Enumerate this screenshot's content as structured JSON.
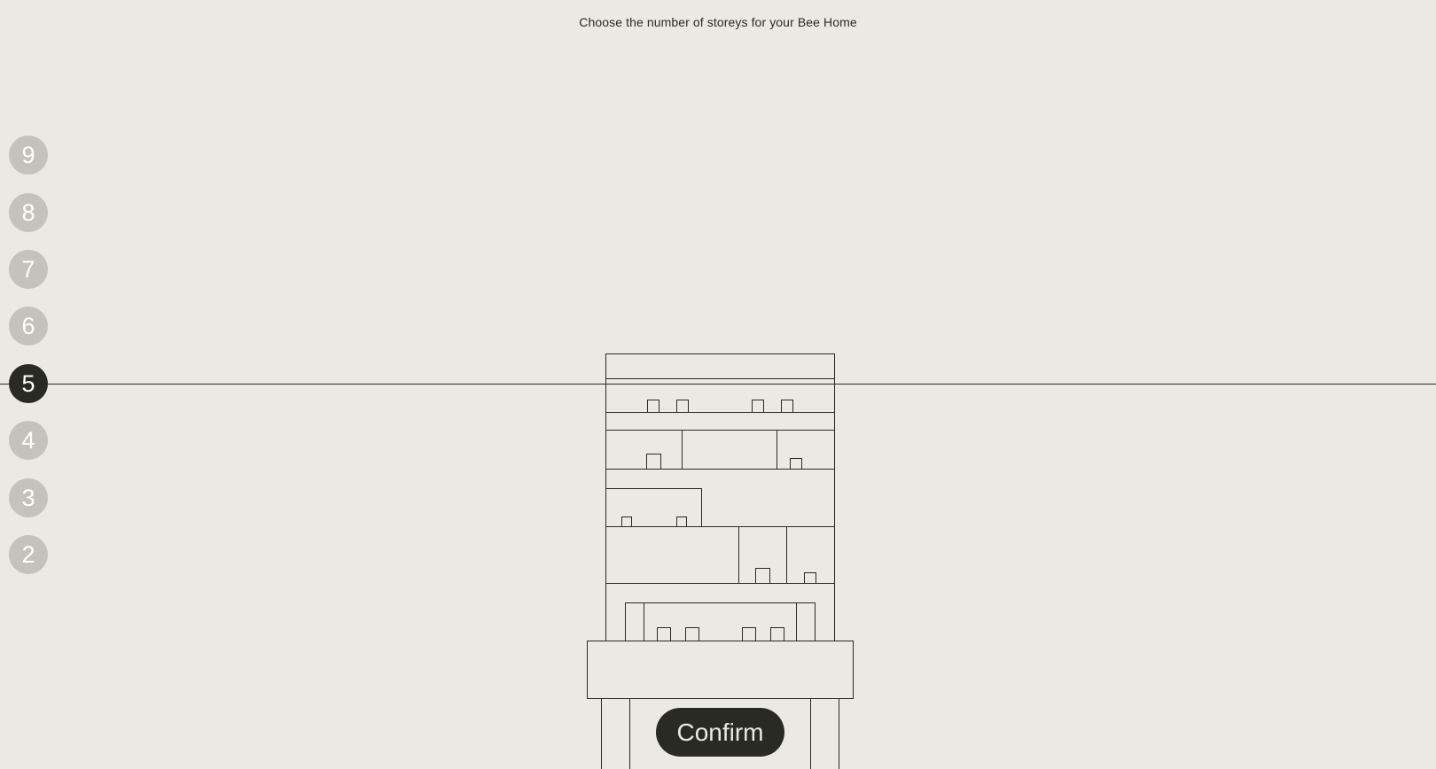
{
  "header": {
    "instruction": "Choose the number of storeys for your Bee Home"
  },
  "storey_selector": {
    "options": [
      "9",
      "8",
      "7",
      "6",
      "5",
      "4",
      "3",
      "2"
    ],
    "selected": "5"
  },
  "actions": {
    "confirm_label": "Confirm"
  },
  "colors": {
    "background": "#eae9e2",
    "ink": "#2a2a24",
    "inactive_button": "#c4c3bb",
    "button_text": "#ffffff"
  }
}
